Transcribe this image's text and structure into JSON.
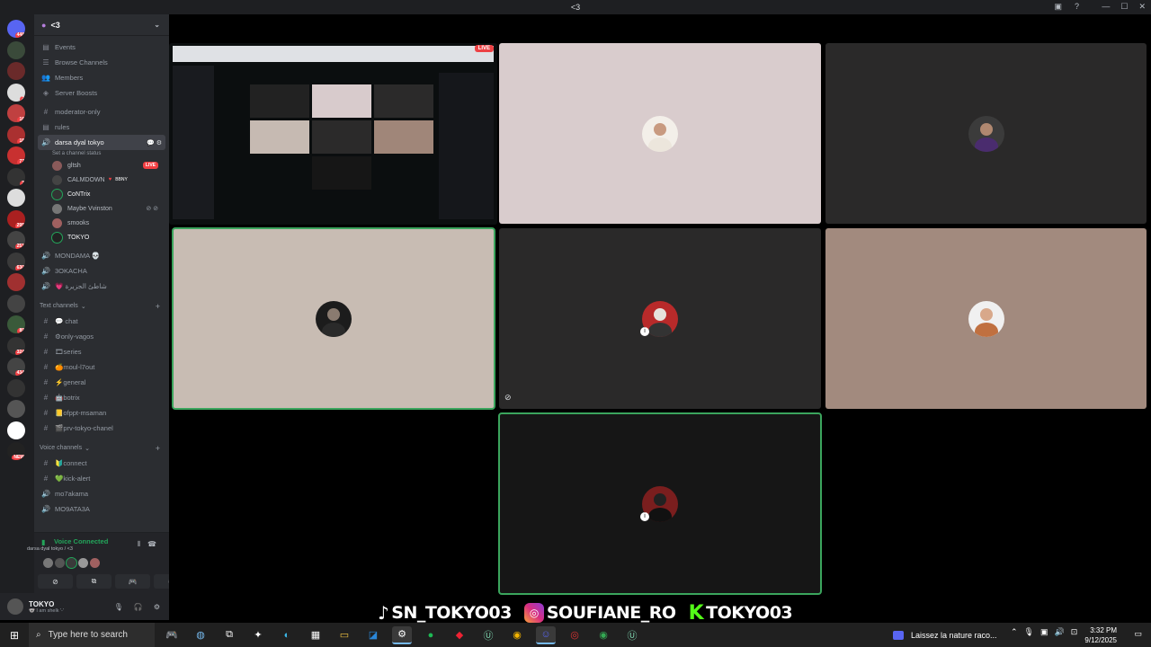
{
  "window": {
    "title": "<3"
  },
  "servers": [
    {
      "badge": "448"
    },
    {
      "badge": ""
    },
    {
      "badge": ""
    },
    {
      "badge": "2"
    },
    {
      "badge": "16"
    },
    {
      "badge": "18"
    },
    {
      "badge": "77"
    },
    {
      "badge": "3"
    },
    {
      "badge": ""
    },
    {
      "badge": "295"
    },
    {
      "badge": "251"
    },
    {
      "badge": "630"
    },
    {
      "badge": ""
    },
    {
      "badge": ""
    },
    {
      "badge": "89"
    },
    {
      "badge": "324"
    },
    {
      "badge": "434"
    },
    {
      "badge": ""
    },
    {
      "badge": ""
    },
    {
      "badge": ""
    },
    {
      "badge": "NEW"
    }
  ],
  "sidebar": {
    "server_name": "<3",
    "top_items": [
      "Events",
      "Browse Channels",
      "Members",
      "Server Boosts"
    ],
    "channels_pre": [
      "moderator-only",
      "rules"
    ],
    "active_voice": {
      "name": "darsa dyal tokyo",
      "status": "Set a channel status"
    },
    "voice_users": [
      {
        "name": "gltsh",
        "live": "LIVE"
      },
      {
        "name": "CALMDOWN",
        "tag": "BBNY"
      },
      {
        "name": "CoNTrix"
      },
      {
        "name": "Maybe Vvinston"
      },
      {
        "name": "smooks"
      },
      {
        "name": "TOKYO"
      }
    ],
    "voice_more": [
      "MONDAMA 💀",
      "3OKACHA",
      "💗 شاطئ الجزيرة"
    ],
    "text_category": "Text channels",
    "text_channels": [
      "💬 chat",
      "⚙only-vagos",
      "🎞series",
      "🍊moul-l7out",
      "⚡general",
      "🤖botrix",
      "📒ofppt-msaman",
      "🎬prv-tokyo-chanel"
    ],
    "voice_category": "Voice channels",
    "voice_channels": [
      "🔰connect",
      "💚kick-alert",
      "mo7akama",
      "MO9ATA3A"
    ]
  },
  "voice_panel": {
    "title": "Voice Connected",
    "subtitle": "darsa dyal tokyo / <3"
  },
  "user_panel": {
    "name": "TOKYO",
    "status": "🐨 I am shelk '-'"
  },
  "stage": {
    "live_label": "LIVE"
  },
  "overlay": {
    "tiktok": "SN_TOKYO03",
    "instagram": "SOUFIANE_RO",
    "kick": "TOKYO03"
  },
  "taskbar": {
    "search_placeholder": "Type here to search",
    "media_title": "Laissez la nature raco...",
    "time": "3:32 PM",
    "date": "9/12/2025"
  },
  "colors": {
    "speaking": "#3ba55d",
    "live": "#ed4245",
    "kick": "#53fc18"
  }
}
